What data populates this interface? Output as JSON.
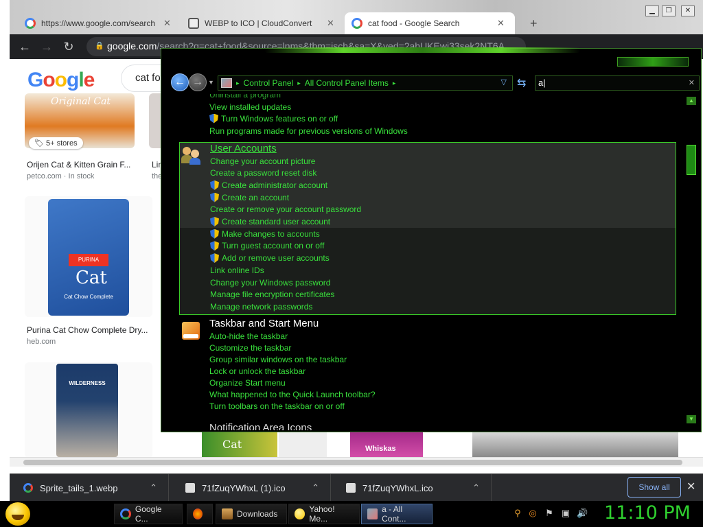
{
  "browser": {
    "tabs": [
      {
        "title": "https://www.google.com/search"
      },
      {
        "title": "WEBP to ICO | CloudConvert"
      },
      {
        "title": "cat food - Google Search"
      }
    ],
    "url_host": "google.com",
    "url_path": "/search?q=cat+food&source=lnms&tbm=isch&sa=X&ved=2ahUKEwi33sek2NT6A"
  },
  "google": {
    "logo": "Google",
    "search_text": "cat foo",
    "products": [
      {
        "name": "Orijen Cat & Kitten Grain F...",
        "source": "petco.com · In stock",
        "badge": "5+ stores",
        "image_text": "Original Cat"
      },
      {
        "name": "Lin",
        "source": "the"
      },
      {
        "name": "Purina Cat Chow Complete Dry...",
        "source": "heb.com",
        "image_text": "Cat Chow Complete"
      },
      {
        "name": "",
        "source": "",
        "image_text": "WILDERNESS"
      }
    ],
    "brand_purina": "PURINA",
    "brand_whiskas": "Whiskas",
    "brand_cat": "Cat"
  },
  "downloads": {
    "items": [
      {
        "name": "Sprite_tails_1.webp"
      },
      {
        "name": "71fZuqYWhxL (1).ico"
      },
      {
        "name": "71fZuqYWhxL.ico"
      }
    ],
    "show_all": "Show all"
  },
  "control_panel": {
    "breadcrumb": [
      "Control Panel",
      "All Control Panel Items"
    ],
    "search_value": "a",
    "partial_top": "Uninstall a program",
    "programs_items": [
      {
        "label": "View installed updates",
        "shield": false
      },
      {
        "label": "Turn Windows features on or off",
        "shield": true
      },
      {
        "label": "Run programs made for previous versions of Windows",
        "shield": false
      }
    ],
    "user_accounts": {
      "title": "User Accounts",
      "items": [
        {
          "label": "Change your account picture",
          "shield": false
        },
        {
          "label": "Create a password reset disk",
          "shield": false
        },
        {
          "label": "Create administrator account",
          "shield": true
        },
        {
          "label": "Create an account",
          "shield": true
        },
        {
          "label": "Create or remove your account password",
          "shield": false
        },
        {
          "label": "Create standard user account",
          "shield": true
        },
        {
          "label": "Make changes to accounts",
          "shield": true
        },
        {
          "label": "Turn guest account on or off",
          "shield": true
        },
        {
          "label": "Add or remove user accounts",
          "shield": true
        },
        {
          "label": "Link online IDs",
          "shield": false
        },
        {
          "label": "Change your Windows password",
          "shield": false
        },
        {
          "label": "Manage file encryption certificates",
          "shield": false
        },
        {
          "label": "Manage network passwords",
          "shield": false
        }
      ]
    },
    "taskbar_start": {
      "title": "Taskbar and Start Menu",
      "items": [
        {
          "label": "Auto-hide the taskbar"
        },
        {
          "label": "Customize the taskbar"
        },
        {
          "label": "Group similar windows on the taskbar"
        },
        {
          "label": "Lock or unlock the taskbar"
        },
        {
          "label": "Organize Start menu"
        },
        {
          "label": "What happened to the Quick Launch toolbar?"
        },
        {
          "label": "Turn toolbars on the taskbar on or off"
        }
      ]
    },
    "partial_bottom": "Notification Area Icons"
  },
  "taskbar": {
    "tasks": [
      {
        "label": "Google C..."
      },
      {
        "label": ""
      },
      {
        "label": "Downloads"
      },
      {
        "label": "Yahoo! Me..."
      },
      {
        "label": "a - All Cont..."
      }
    ],
    "clock": "11:10 PM"
  },
  "colors": {
    "cp_link": "#39e03c",
    "cp_background": "#000000",
    "clock": "#2fd12f",
    "chrome_left_bar": "#e8201c"
  }
}
